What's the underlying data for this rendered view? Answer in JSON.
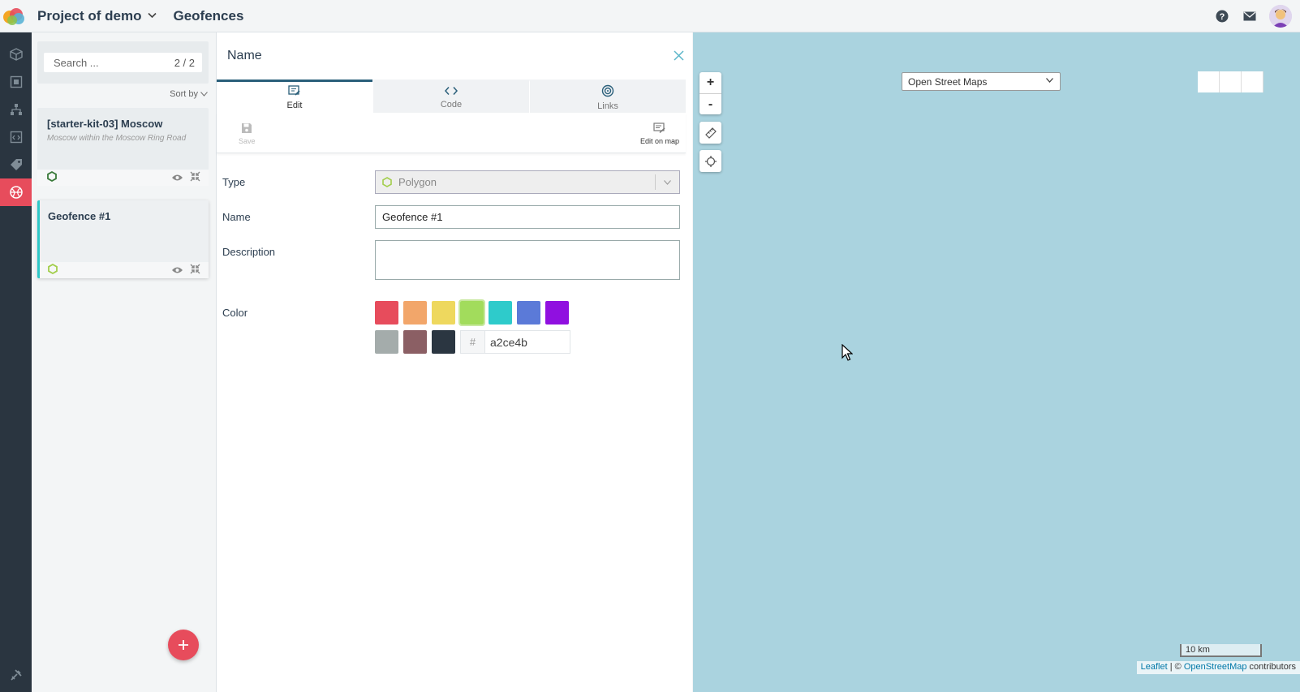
{
  "header": {
    "project_name": "Project of demo",
    "page_title": "Geofences"
  },
  "sidebar": {
    "items": [
      {
        "icon": "cube-icon"
      },
      {
        "icon": "device-icon"
      },
      {
        "icon": "hierarchy-icon"
      },
      {
        "icon": "code-window-icon"
      },
      {
        "icon": "tag-icon"
      },
      {
        "icon": "geofence-globe-icon",
        "active": true
      }
    ],
    "bottom_icon": "tools-icon"
  },
  "list": {
    "search_placeholder": "Search ...",
    "count": "2 / 2",
    "sort_label": "Sort by",
    "items": [
      {
        "title": "[starter-kit-03] Moscow",
        "description": "Moscow within the Moscow Ring Road",
        "shape_color": "#3a7a3a"
      },
      {
        "title": "Geofence #1",
        "description": "",
        "shape_color": "#a2ce4b",
        "selected": true
      }
    ]
  },
  "editor": {
    "title": "Name",
    "tabs": [
      {
        "label": "Edit",
        "active": true
      },
      {
        "label": "Code"
      },
      {
        "label": "Links"
      }
    ],
    "toolbar": {
      "save_label": "Save",
      "edit_on_map_label": "Edit on map"
    },
    "form": {
      "type_label": "Type",
      "type_value": "Polygon",
      "name_label": "Name",
      "name_value": "Geofence #1",
      "description_label": "Description",
      "description_value": "",
      "color_label": "Color",
      "color_hex": "a2ce4b",
      "hash": "#",
      "swatches": [
        "#e74c5c",
        "#f2a66a",
        "#eed85e",
        "#a2dc5c",
        "#2ecbcb",
        "#5b7ad8",
        "#9010e0",
        "#a4acab",
        "#8b5f64",
        "#2b3641"
      ],
      "selected_swatch": "#a2dc5c"
    }
  },
  "map": {
    "background": "#aad3df",
    "layer": "Open Street Maps",
    "zoom_in": "+",
    "zoom_out": "-",
    "scale": "10 km",
    "attribution": {
      "leaflet": "Leaflet",
      "sep": " | © ",
      "osm": "OpenStreetMap",
      "contributors": " contributors"
    }
  },
  "colors": {
    "accent": "#e74c5c",
    "tab_active": "#2a5f7a",
    "selected_bar": "#2ec8c8"
  }
}
